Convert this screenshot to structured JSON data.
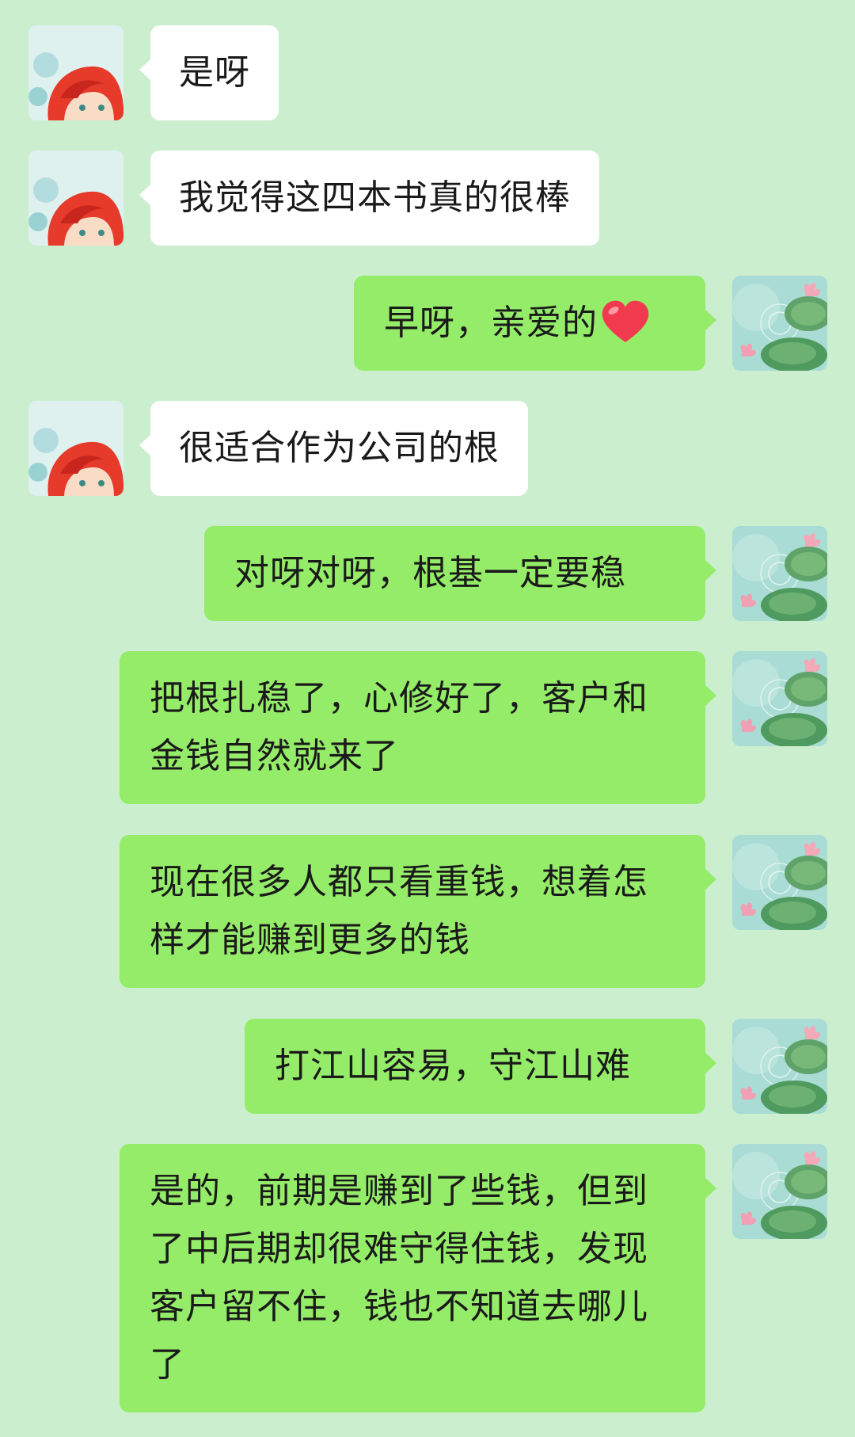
{
  "conversation": {
    "messages": [
      {
        "side": "in",
        "text": "是呀"
      },
      {
        "side": "in",
        "text": "我觉得这四本书真的很棒"
      },
      {
        "side": "out",
        "text": "早呀，亲爱的",
        "emoji": "red-heart"
      },
      {
        "side": "in",
        "text": "很适合作为公司的根"
      },
      {
        "side": "out",
        "text": "对呀对呀，根基一定要稳"
      },
      {
        "side": "out",
        "text": "把根扎稳了，心修好了，客户和金钱自然就来了"
      },
      {
        "side": "out",
        "text": "现在很多人都只看重钱，想着怎样才能赚到更多的钱"
      },
      {
        "side": "out",
        "text": "打江山容易，守江山难"
      },
      {
        "side": "out",
        "text": "是的，前期是赚到了些钱，但到了中后期却很难守得住钱，发现客户留不住，钱也不知道去哪儿了"
      }
    ]
  },
  "colors": {
    "background": "#cbeecf",
    "incoming_bubble": "#ffffff",
    "outgoing_bubble": "#95ec69",
    "text": "#1a1a1a"
  },
  "icons": {
    "contact_avatar": "red-haired-girl-avatar-icon",
    "self_avatar": "lotus-pond-avatar-icon",
    "emoji": "red-heart-emoji-icon"
  }
}
